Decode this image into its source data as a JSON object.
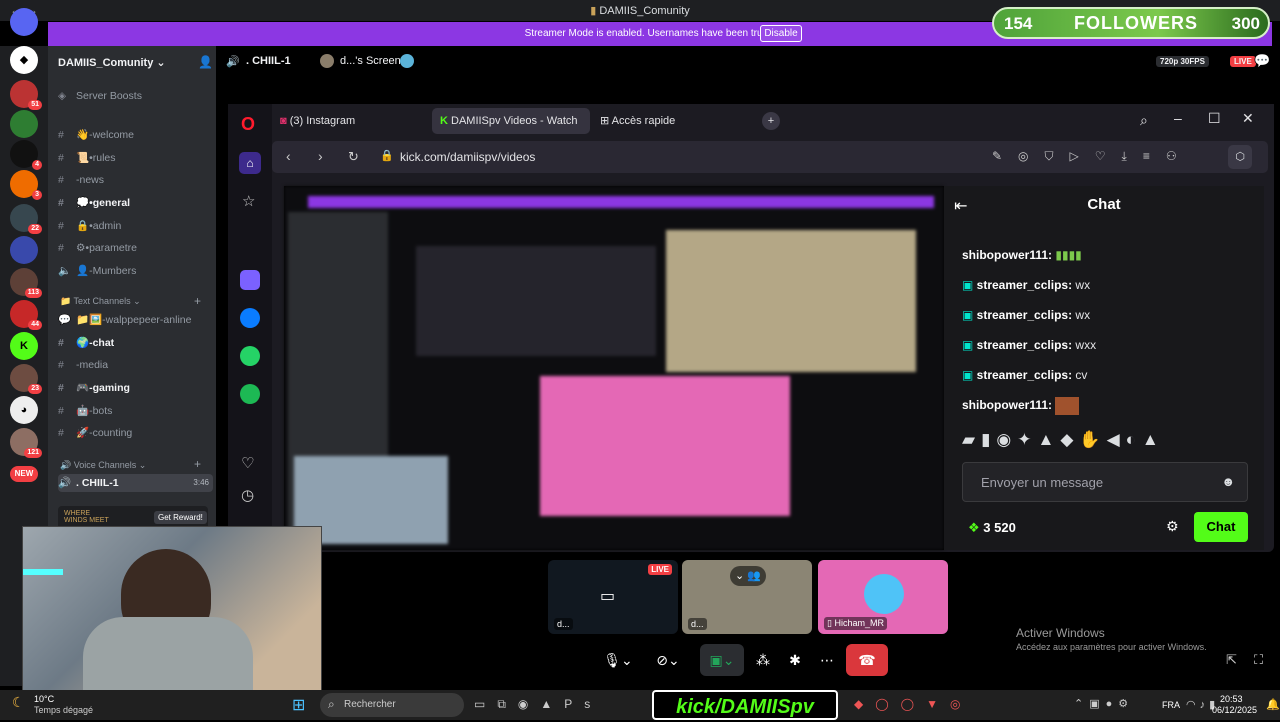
{
  "window": {
    "title": "DAMIIS_Comunity",
    "back_arrow": "←",
    "fwd_arrow": "→"
  },
  "banner": {
    "text": "Streamer Mode is enabled. Usernames have been truncated.",
    "disable_label": "Disable"
  },
  "followers": {
    "current": "154",
    "label": "FOLLOWERS",
    "goal": "300"
  },
  "guild_badges": [
    "51",
    "4",
    "3",
    "22",
    "113",
    "44",
    "23",
    "121"
  ],
  "guild_new": "NEW",
  "server": {
    "name": "DAMIIS_Comunity",
    "chevron": "⌄"
  },
  "channels": {
    "boosts": "Server Boosts",
    "top": [
      {
        "label": "👋-welcome"
      },
      {
        "label": "📜•rules"
      },
      {
        "label": "-news"
      },
      {
        "label": "💭•general",
        "bright": true
      },
      {
        "label": "🔒•admin"
      },
      {
        "label": "⚙•parametre"
      },
      {
        "label": "👤-Mumbers"
      }
    ],
    "text_category": "Text Channels",
    "text": [
      {
        "label": "📁🖼️-walppepeer-anline"
      },
      {
        "label": "🌍-chat",
        "bright": true
      },
      {
        "label": "-media"
      },
      {
        "label": "🎮-gaming",
        "bright": true
      },
      {
        "label": "🤖-bots"
      },
      {
        "label": "🚀-counting"
      }
    ],
    "voice_category": "Voice Channels",
    "voice": {
      "label": ". CHIIL-1",
      "time": "3:46"
    }
  },
  "promo": {
    "text": "WHERE WINDS MEET",
    "button": "Get Reward!"
  },
  "voice_header": {
    "channel": ". CHIIL-1",
    "screen": "d...'s Screen",
    "quality": "720p 30FPS",
    "live": "LIVE"
  },
  "browser": {
    "tabs": [
      "(3) Instagram",
      "DAMIISpv Videos - Watch",
      "Accès rapide"
    ],
    "url": "kick.com/damiispv/videos"
  },
  "kick_chat": {
    "title": "Chat",
    "messages": [
      {
        "user": "shibopower111:",
        "msg": "▮▮▮▮"
      },
      {
        "user": "streamer_cclips:",
        "msg": "wx"
      },
      {
        "user": "streamer_cclips:",
        "msg": "wx"
      },
      {
        "user": "streamer_cclips:",
        "msg": "wxx"
      },
      {
        "user": "streamer_cclips:",
        "msg": "cv"
      },
      {
        "user": "shibopower111:",
        "msg": ""
      }
    ],
    "placeholder": "Envoyer un message",
    "points": "3 520",
    "send": "Chat"
  },
  "tiles": [
    {
      "name": "d...",
      "live": "LIVE"
    },
    {
      "name": "d..."
    },
    {
      "name": "Hicham_MR"
    }
  ],
  "activate": {
    "title": "Activer Windows",
    "sub": "Accédez aux paramètres pour activer Windows."
  },
  "taskbar": {
    "temp": "10°C",
    "weather": "Temps dégagé",
    "search": "Rechercher",
    "kick_badge": "kick/DAMIISpv",
    "lang": "FRA",
    "time": "20:53",
    "date": "06/12/2025"
  }
}
